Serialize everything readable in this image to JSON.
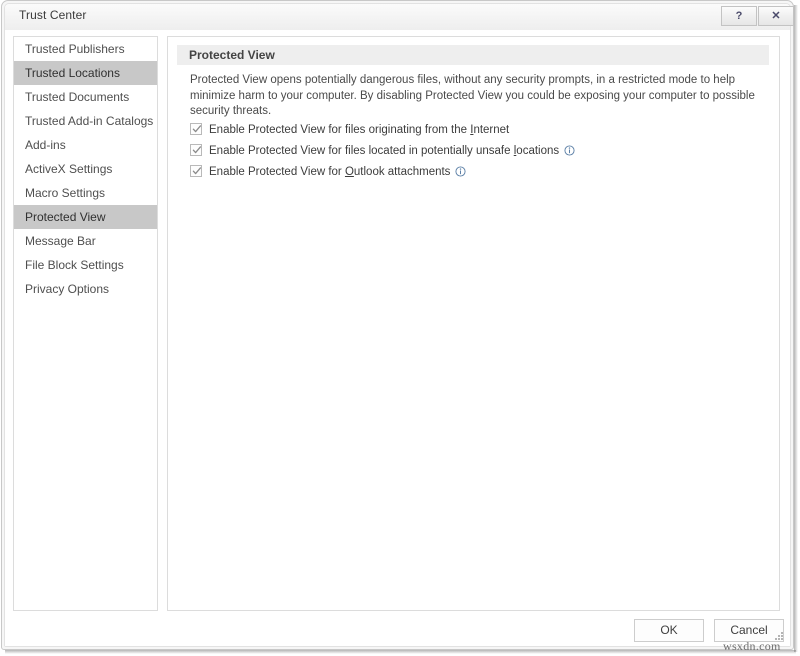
{
  "window": {
    "title": "Trust Center",
    "help_button": "?",
    "close_button": "✕"
  },
  "sidebar": {
    "items": [
      {
        "label": "Trusted Publishers",
        "state": "normal"
      },
      {
        "label": "Trusted Locations",
        "state": "hovered"
      },
      {
        "label": "Trusted Documents",
        "state": "normal"
      },
      {
        "label": "Trusted Add-in Catalogs",
        "state": "normal"
      },
      {
        "label": "Add-ins",
        "state": "normal"
      },
      {
        "label": "ActiveX Settings",
        "state": "normal"
      },
      {
        "label": "Macro Settings",
        "state": "normal"
      },
      {
        "label": "Protected View",
        "state": "selected"
      },
      {
        "label": "Message Bar",
        "state": "normal"
      },
      {
        "label": "File Block Settings",
        "state": "normal"
      },
      {
        "label": "Privacy Options",
        "state": "normal"
      }
    ]
  },
  "content": {
    "section_title": "Protected View",
    "description": "Protected View opens potentially dangerous files, without any security prompts, in a restricted mode to help minimize harm to your computer. By disabling Protected View you could be exposing your computer to possible security threats.",
    "checkboxes": [
      {
        "checked": true,
        "text_before": "Enable Protected View for files originating from the ",
        "accesskey": "I",
        "text_after": "nternet",
        "has_info_icon": false
      },
      {
        "checked": true,
        "text_before": "Enable Protected View for files located in potentially unsafe ",
        "accesskey": "l",
        "text_after": "ocations",
        "has_info_icon": true
      },
      {
        "checked": true,
        "text_before": "Enable Protected View for ",
        "accesskey": "O",
        "text_after": "utlook attachments",
        "has_info_icon": true
      }
    ]
  },
  "footer": {
    "ok_label": "OK",
    "cancel_label": "Cancel"
  },
  "watermark": {
    "text": "wsxdn.com"
  },
  "colors": {
    "selected_nav_bg": "#c8c8c8",
    "section_header_bg": "#eeeeee",
    "info_icon": "#5b7fa6",
    "panel_border": "#dcdcdc",
    "title_text": "#3b3b3b"
  }
}
